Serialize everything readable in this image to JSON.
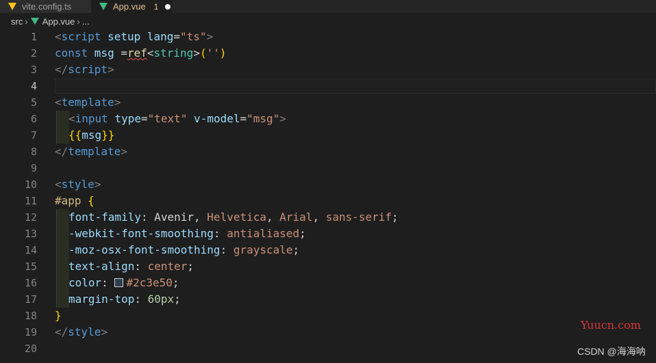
{
  "tabs": [
    {
      "label": "vite.config.ts"
    },
    {
      "label": "App.vue",
      "badge": "1"
    }
  ],
  "breadcrumb": {
    "folder": "src",
    "file": "App.vue",
    "ellipsis": "..."
  },
  "lines": [
    "1",
    "2",
    "3",
    "4",
    "5",
    "6",
    "7",
    "8",
    "9",
    "10",
    "11",
    "12",
    "13",
    "14",
    "15",
    "16",
    "17",
    "18",
    "19",
    "20"
  ],
  "code": {
    "l1": {
      "o": "<",
      "t": "script",
      "a1": " setup",
      "a2": " lang",
      "eq": "=",
      "s": "\"ts\"",
      "c": ">"
    },
    "l2": {
      "k": "const",
      "v": " msg",
      "eq": " =",
      "f": "ref",
      "lt": "<",
      "ty": "string",
      "gt": ">",
      "p1": "(",
      "s": "''",
      "p2": ")"
    },
    "l3": {
      "o": "</",
      "t": "script",
      "c": ">"
    },
    "l5": {
      "o": "<",
      "t": "template",
      "c": ">"
    },
    "l6": {
      "o": "<",
      "t": "input",
      "a1": " type",
      "eq1": "=",
      "s1": "\"text\"",
      "a2": " v-model",
      "eq2": "=",
      "s2": "\"msg\"",
      "c": ">"
    },
    "l7": {
      "b1": "{{",
      "v": "msg",
      "b2": "}}"
    },
    "l8": {
      "o": "</",
      "t": "template",
      "c": ">"
    },
    "l10": {
      "o": "<",
      "t": "style",
      "c": ">"
    },
    "l11": {
      "sel": "#app",
      "br": " {"
    },
    "l12": {
      "p": "font-family",
      "c": ": ",
      "v1": "Avenir",
      "cm1": ", ",
      "v2": "Helvetica",
      "cm2": ", ",
      "v3": "Arial",
      "cm3": ", ",
      "v4": "sans-serif",
      "sc": ";"
    },
    "l13": {
      "p": "-webkit-font-smoothing",
      "c": ": ",
      "v": "antialiased",
      "sc": ";"
    },
    "l14": {
      "p": "-moz-osx-font-smoothing",
      "c": ": ",
      "v": "grayscale",
      "sc": ";"
    },
    "l15": {
      "p": "text-align",
      "c": ": ",
      "v": "center",
      "sc": ";"
    },
    "l16": {
      "p": "color",
      "c": ": ",
      "v": "#2c3e50",
      "sc": ";"
    },
    "l17": {
      "p": "margin-top",
      "c": ": ",
      "v": "60px",
      "sc": ";"
    },
    "l18": {
      "br": "}"
    },
    "l19": {
      "o": "</",
      "t": "style",
      "c": ">"
    }
  },
  "watermark": {
    "site": "Yuucn.com",
    "credit": "CSDN @海海呐"
  },
  "colors": {
    "swatch": "#2c3e50"
  }
}
